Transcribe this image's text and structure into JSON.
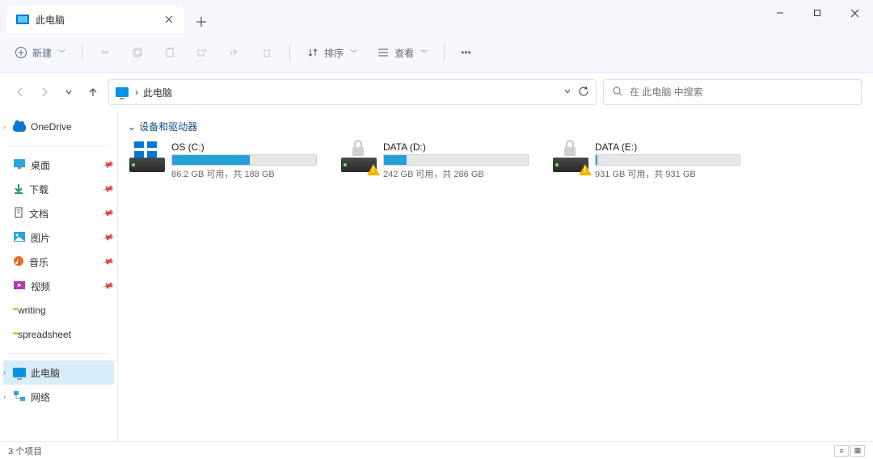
{
  "window": {
    "tab_title": "此电脑",
    "new_button": "新建",
    "sort_label": "排序",
    "view_label": "查看"
  },
  "nav": {
    "breadcrumb": "此电脑",
    "separator": "›"
  },
  "search": {
    "placeholder": "在 此电脑 中搜索"
  },
  "sidebar": {
    "onedrive": "OneDrive",
    "quick": [
      {
        "label": "桌面",
        "icon": "desktop",
        "color": "#2aa6e0"
      },
      {
        "label": "下载",
        "icon": "download",
        "color": "#1ba05a"
      },
      {
        "label": "文档",
        "icon": "document",
        "color": "#6a6a6a"
      },
      {
        "label": "图片",
        "icon": "pictures",
        "color": "#2aa6e0"
      },
      {
        "label": "音乐",
        "icon": "music",
        "color": "#e06c2a"
      },
      {
        "label": "视频",
        "icon": "video",
        "color": "#b23ab2"
      },
      {
        "label": "writing",
        "icon": "folder",
        "color": "#f5c24b"
      },
      {
        "label": "spreadsheet",
        "icon": "folder",
        "color": "#f5c24b"
      }
    ],
    "this_pc": "此电脑",
    "network": "网络"
  },
  "content": {
    "group_header": "设备和驱动器",
    "drives": [
      {
        "name": "OS (C:)",
        "free_text": "86.2 GB 可用，共 188 GB",
        "fill_pct": 54,
        "kind": "os"
      },
      {
        "name": "DATA (D:)",
        "free_text": "242 GB 可用，共 286 GB",
        "fill_pct": 16,
        "kind": "locked"
      },
      {
        "name": "DATA (E:)",
        "free_text": "931 GB 可用，共 931 GB",
        "fill_pct": 1,
        "kind": "locked"
      }
    ]
  },
  "status": {
    "count_text": "3 个项目"
  }
}
